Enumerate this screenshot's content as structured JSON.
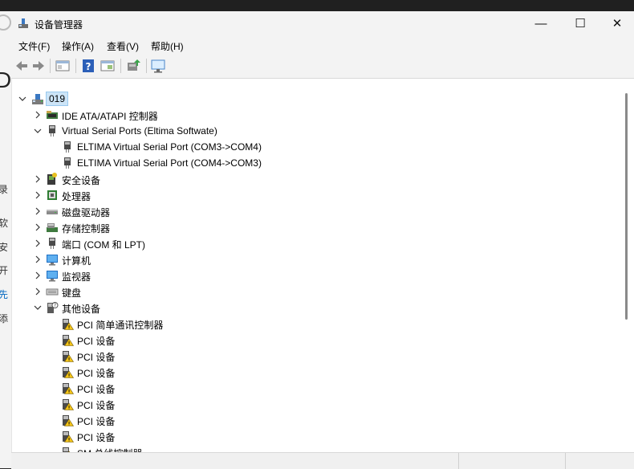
{
  "window": {
    "title": "设备管理器",
    "controls": {
      "minimize": "—",
      "maximize": "☐",
      "close": "✕"
    }
  },
  "menu": [
    {
      "label": "文件(F)"
    },
    {
      "label": "操作(A)"
    },
    {
      "label": "查看(V)"
    },
    {
      "label": "帮助(H)"
    }
  ],
  "toolbar": [
    {
      "name": "back-icon"
    },
    {
      "name": "forward-icon"
    },
    {
      "name": "show-hide-console-tree-icon"
    },
    {
      "name": "help-icon"
    },
    {
      "name": "properties-icon"
    },
    {
      "name": "update-driver-icon"
    },
    {
      "name": "scan-hardware-icon"
    }
  ],
  "background": {
    "labels": [
      "录",
      "软",
      "安",
      "开",
      "先",
      "添"
    ]
  },
  "tree": {
    "root": {
      "label": "019",
      "icon": "computer-icon"
    },
    "items": [
      {
        "label": "IDE ATA/ATAPI 控制器",
        "icon": "ide-controller-icon",
        "level": 1,
        "state": "collapsed"
      },
      {
        "label": "Virtual Serial Ports (Eltima Softwate)",
        "icon": "port-icon",
        "level": 1,
        "state": "expanded"
      },
      {
        "label": "ELTIMA Virtual Serial Port (COM3->COM4)",
        "icon": "port-icon",
        "level": 2,
        "state": "leaf"
      },
      {
        "label": "ELTIMA Virtual Serial Port (COM4->COM3)",
        "icon": "port-icon",
        "level": 2,
        "state": "leaf"
      },
      {
        "label": "安全设备",
        "icon": "security-device-icon",
        "level": 1,
        "state": "collapsed"
      },
      {
        "label": "处理器",
        "icon": "processor-icon",
        "level": 1,
        "state": "collapsed"
      },
      {
        "label": "磁盘驱动器",
        "icon": "disk-drive-icon",
        "level": 1,
        "state": "collapsed"
      },
      {
        "label": "存储控制器",
        "icon": "storage-controller-icon",
        "level": 1,
        "state": "collapsed"
      },
      {
        "label": "端口 (COM 和 LPT)",
        "icon": "port-icon",
        "level": 1,
        "state": "collapsed"
      },
      {
        "label": "计算机",
        "icon": "monitor-icon",
        "level": 1,
        "state": "collapsed"
      },
      {
        "label": "监视器",
        "icon": "monitor-icon",
        "level": 1,
        "state": "collapsed"
      },
      {
        "label": "键盘",
        "icon": "keyboard-icon",
        "level": 1,
        "state": "collapsed"
      },
      {
        "label": "其他设备",
        "icon": "unknown-device-icon",
        "level": 1,
        "state": "expanded"
      },
      {
        "label": "PCI 简单通讯控制器",
        "icon": "warning-device-icon",
        "level": 2,
        "state": "leaf"
      },
      {
        "label": "PCI 设备",
        "icon": "warning-device-icon",
        "level": 2,
        "state": "leaf"
      },
      {
        "label": "PCI 设备",
        "icon": "warning-device-icon",
        "level": 2,
        "state": "leaf"
      },
      {
        "label": "PCI 设备",
        "icon": "warning-device-icon",
        "level": 2,
        "state": "leaf"
      },
      {
        "label": "PCI 设备",
        "icon": "warning-device-icon",
        "level": 2,
        "state": "leaf"
      },
      {
        "label": "PCI 设备",
        "icon": "warning-device-icon",
        "level": 2,
        "state": "leaf"
      },
      {
        "label": "PCI 设备",
        "icon": "warning-device-icon",
        "level": 2,
        "state": "leaf"
      },
      {
        "label": "PCI 设备",
        "icon": "warning-device-icon",
        "level": 2,
        "state": "leaf"
      },
      {
        "label": "SM 总线控制器",
        "icon": "warning-device-icon",
        "level": 2,
        "state": "leaf"
      }
    ]
  },
  "colors": {
    "selection": "#cce4f7",
    "chrome": "#f3f3f3",
    "warning": "#f5c518"
  }
}
